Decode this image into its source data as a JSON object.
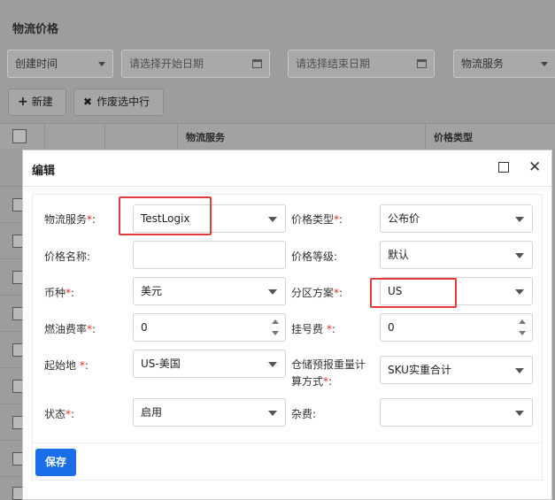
{
  "page": {
    "title": "物流价格",
    "filters": {
      "created_select": "创建时间",
      "start_date_placeholder": "请选择开始日期",
      "end_date_placeholder": "请选择结束日期",
      "service_select": "物流服务"
    },
    "toolbar": {
      "new_label": "新建",
      "void_label": "作废选中行"
    },
    "table": {
      "headers": [
        "物流服务",
        "价格类型"
      ]
    }
  },
  "dialog": {
    "title": "编辑",
    "fields": {
      "service": {
        "label": "物流服务",
        "value": "TestLogix"
      },
      "price_type": {
        "label": "价格类型",
        "value": "公布价"
      },
      "price_name": {
        "label": "价格名称",
        "value": ""
      },
      "price_level": {
        "label": "价格等级",
        "value": "默认"
      },
      "currency": {
        "label": "币种",
        "value": "美元"
      },
      "zone_plan": {
        "label": "分区方案",
        "value": "US"
      },
      "fuel_rate": {
        "label": "燃油费率",
        "value": "0"
      },
      "registration_fee": {
        "label": "挂号费",
        "value": "0"
      },
      "origin": {
        "label": "起始地",
        "value": "US-美国"
      },
      "weight_calc_line1": "仓储预报重量计",
      "weight_calc_line2": "算方式",
      "weight_calc_value": "SKU实重合计",
      "status": {
        "label": "状态",
        "value": "启用"
      },
      "misc_fee": {
        "label": "杂费",
        "value": ""
      }
    },
    "required_mark": "*",
    "colon": ":",
    "save_label": "保存"
  },
  "colors": {
    "primary": "#1a6fe8",
    "required": "#e0301e",
    "highlight": "#e23b3b"
  }
}
